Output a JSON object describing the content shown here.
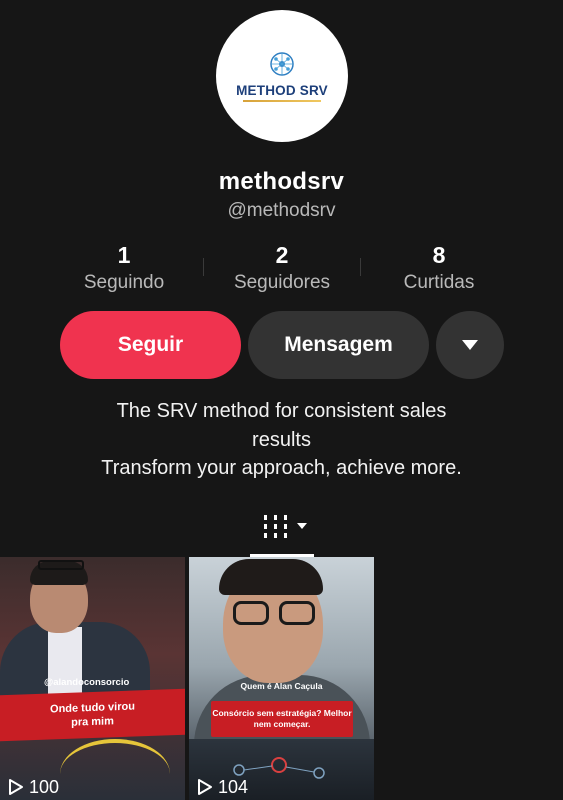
{
  "profile": {
    "avatar_logo_text": "METHOD SRV",
    "display_name": "methodsrv",
    "handle": "@methodsrv"
  },
  "stats": [
    {
      "value": "1",
      "label": "Seguindo"
    },
    {
      "value": "2",
      "label": "Seguidores"
    },
    {
      "value": "8",
      "label": "Curtidas"
    }
  ],
  "actions": {
    "follow_label": "Seguir",
    "message_label": "Mensagem",
    "more_icon": "caret-down-icon"
  },
  "bio": {
    "line1": "The SRV method for consistent sales",
    "line2": "results",
    "line3": "Transform your approach, achieve more."
  },
  "tabs": {
    "active_icon": "grid-filter-icon"
  },
  "colors": {
    "background": "#161616",
    "follow_button": "#f0334f",
    "secondary_button": "#333333",
    "muted_text": "#b9b9b9",
    "banner_red": "#c81e24"
  },
  "videos": [
    {
      "overlay_handle": "@alandoconsorcio",
      "banner_line1": "Onde tudo virou",
      "banner_line2": "pra mim",
      "views": "100"
    },
    {
      "caption_top": "Quem é Alan Caçula",
      "banner_line1": "Consórcio sem estratégia? Melhor",
      "banner_line2": "nem começar.",
      "views": "104"
    }
  ]
}
